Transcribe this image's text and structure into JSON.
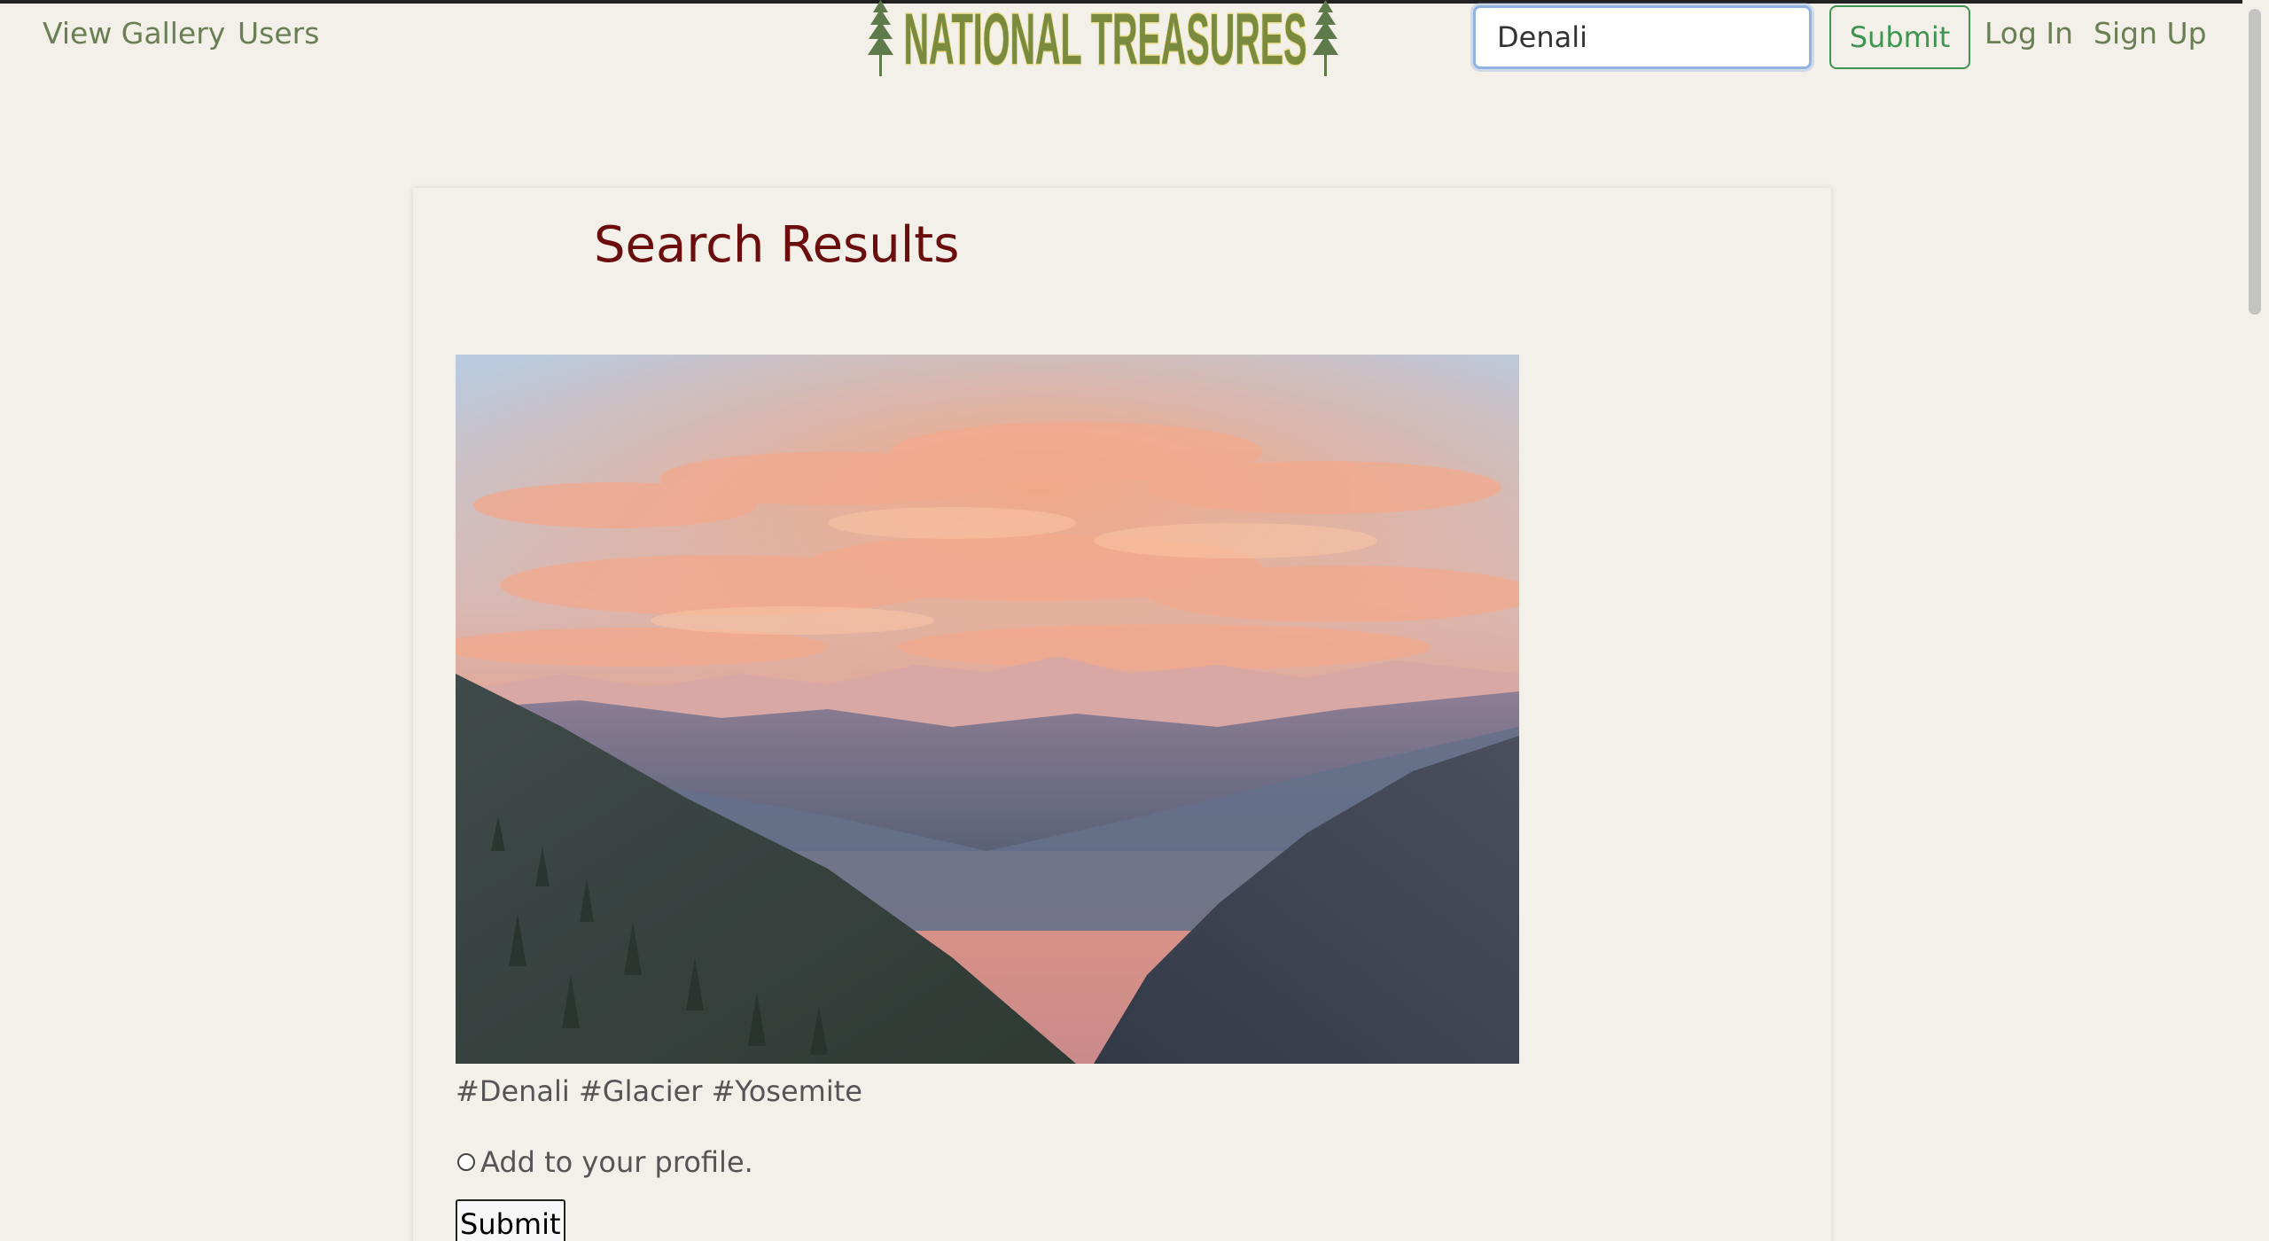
{
  "nav": {
    "view_gallery": "View Gallery",
    "users": "Users",
    "brand": "NATIONAL TREASURES",
    "search_value": "Denali",
    "search_submit": "Submit",
    "log_in": "Log In",
    "sign_up": "Sign Up"
  },
  "main": {
    "title": "Search Results",
    "results": [
      {
        "image": "mountain-sunset-photo",
        "tags": "#Denali #Glacier #Yosemite",
        "add_to_profile_label": "Add to your profile.",
        "add_to_profile_checked": false,
        "submit_label": "Submit"
      }
    ]
  },
  "colors": {
    "background": "#f3efe9",
    "nav_link": "#6b7f55",
    "title": "#6b0d0d",
    "submit_green": "#3f9450",
    "brand_fill": "#7a8a3e",
    "brand_outline": "#e9dd8a",
    "tree": "#5f7a4a"
  }
}
